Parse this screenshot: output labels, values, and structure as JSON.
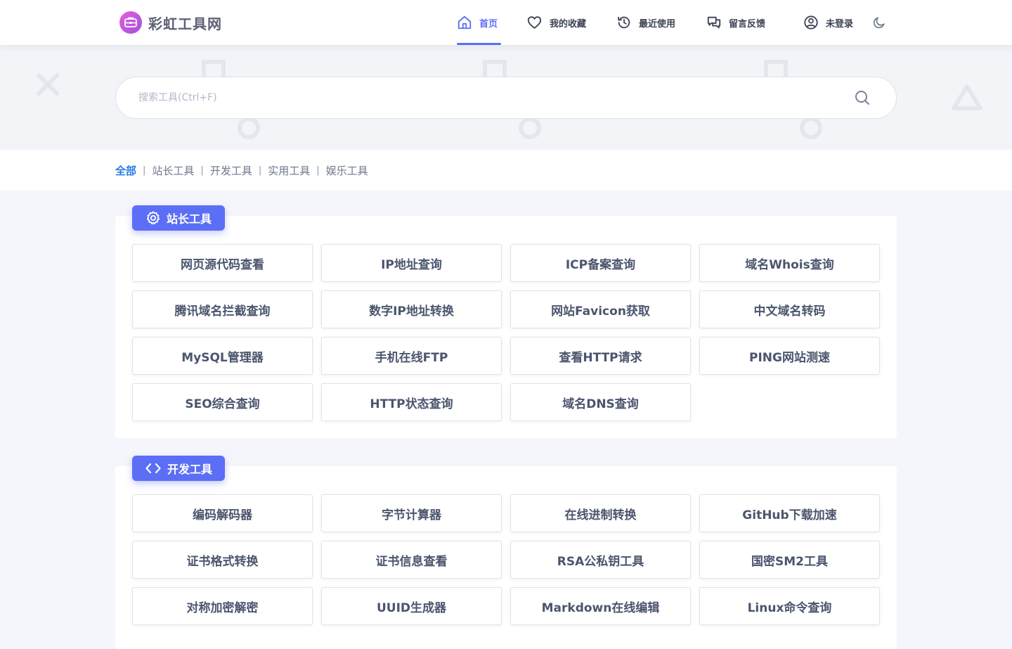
{
  "header": {
    "logo_text": "彩虹工具网",
    "nav": [
      {
        "label": "首页",
        "icon": "home-icon",
        "active": true
      },
      {
        "label": "我的收藏",
        "icon": "heart-icon"
      },
      {
        "label": "最近使用",
        "icon": "history-icon"
      },
      {
        "label": "留言反馈",
        "icon": "chat-icon"
      },
      {
        "label": "未登录",
        "icon": "user-icon"
      }
    ],
    "theme_toggle_icon": "moon-icon"
  },
  "search": {
    "placeholder": "搜索工具(Ctrl+F)",
    "value": "",
    "icon": "search-icon"
  },
  "filter": {
    "items": [
      "全部",
      "站长工具",
      "开发工具",
      "实用工具",
      "娱乐工具"
    ],
    "active_index": 0
  },
  "sections": [
    {
      "title": "站长工具",
      "icon": "gear-icon",
      "tools": [
        "网页源代码查看",
        "IP地址查询",
        "ICP备案查询",
        "域名Whois查询",
        "腾讯域名拦截查询",
        "数字IP地址转换",
        "网站Favicon获取",
        "中文域名转码",
        "MySQL管理器",
        "手机在线FTP",
        "查看HTTP请求",
        "PING网站测速",
        "SEO综合查询",
        "HTTP状态查询",
        "域名DNS查询"
      ]
    },
    {
      "title": "开发工具",
      "icon": "code-icon",
      "tools": [
        "编码解码器",
        "字节计算器",
        "在线进制转换",
        "GitHub下载加速",
        "证书格式转换",
        "证书信息查看",
        "RSA公私钥工具",
        "国密SM2工具",
        "对称加密解密",
        "UUID生成器",
        "Markdown在线编辑",
        "Linux命令查询"
      ]
    }
  ],
  "colors": {
    "accent": "#5b6ef5",
    "filter_active": "#2a7ae2",
    "text": "#4b556d",
    "background": "#f5f6fb"
  }
}
